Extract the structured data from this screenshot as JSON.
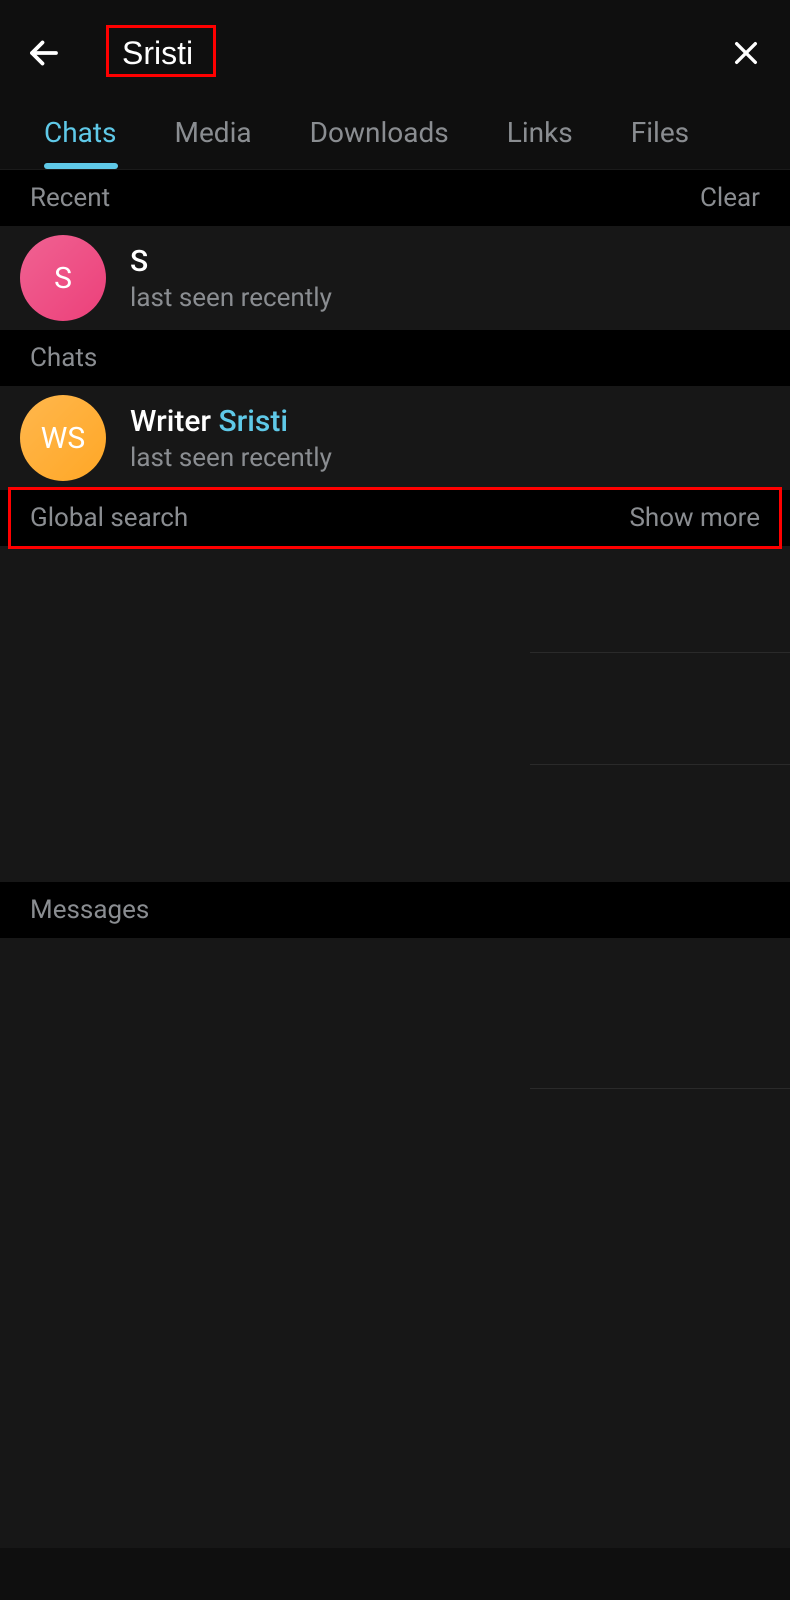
{
  "search": {
    "value": "Sristi"
  },
  "tabs": {
    "chats": "Chats",
    "media": "Media",
    "downloads": "Downloads",
    "links": "Links",
    "files": "Files"
  },
  "sections": {
    "recent": {
      "title": "Recent",
      "action": "Clear"
    },
    "chats": {
      "title": "Chats"
    },
    "global": {
      "title": "Global search",
      "action": "Show more"
    },
    "messages": {
      "title": "Messages"
    }
  },
  "recent_items": [
    {
      "avatar_text": "S",
      "title": "S",
      "subtitle": "last seen recently"
    }
  ],
  "chat_items": [
    {
      "avatar_text": "WS",
      "title_prefix": "Writer ",
      "title_highlight": "Sristi",
      "subtitle": "last seen recently"
    }
  ]
}
